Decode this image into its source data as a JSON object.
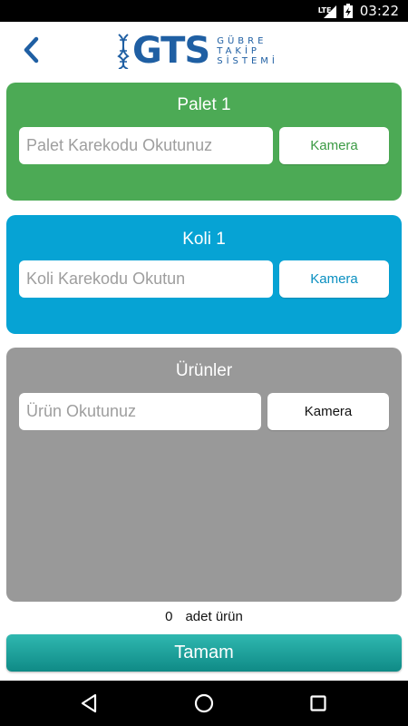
{
  "status_bar": {
    "network": "LTE",
    "time": "03:22"
  },
  "header": {
    "logo_main": "GTS",
    "logo_sub": [
      "GÜBRE",
      "TAKİP",
      "SİSTEMİ"
    ],
    "back_icon": "chevron-left-icon"
  },
  "palet": {
    "title": "Palet 1",
    "input_placeholder": "Palet Karekodu Okutunuz",
    "input_value": "",
    "camera_label": "Kamera"
  },
  "koli": {
    "title": "Koli 1",
    "input_placeholder": "Koli Karekodu Okutun",
    "input_value": "",
    "camera_label": "Kamera"
  },
  "urunler": {
    "title": "Ürünler",
    "input_placeholder": "Ürün Okutunuz",
    "input_value": "",
    "camera_label": "Kamera"
  },
  "count": {
    "value": "0",
    "label": "adet ürün"
  },
  "done_button": "Tamam",
  "colors": {
    "palet_bg": "#4caa55",
    "koli_bg": "#06a3d4",
    "urun_bg": "#999999",
    "logo": "#1f5fa3",
    "palet_camera_text": "#3b9a44",
    "koli_camera_text": "#0a8fc0",
    "urun_camera_text": "#111111"
  },
  "nav": {
    "back": "back-triangle-icon",
    "home": "home-circle-icon",
    "recents": "recents-square-icon"
  }
}
